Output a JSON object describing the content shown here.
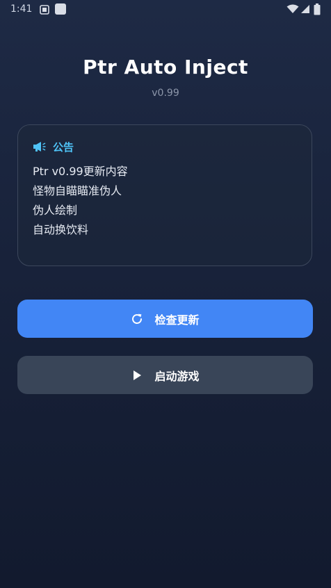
{
  "status_bar": {
    "time": "1:41"
  },
  "app": {
    "title": "Ptr Auto Inject",
    "version": "v0.99"
  },
  "notice": {
    "title": "公告",
    "icon": "megaphone-icon",
    "lines": [
      "Ptr v0.99更新内容",
      "怪物自瞄瞄准伪人",
      "伪人绘制",
      "自动换饮料"
    ]
  },
  "buttons": {
    "update_label": "检查更新",
    "update_icon": "refresh-icon",
    "start_label": "启动游戏",
    "start_icon": "play-icon"
  },
  "colors": {
    "accent_blue": "#4286f5",
    "notice_title": "#4fc3f7",
    "secondary_button": "#394558",
    "background_top": "#1e2a45",
    "background_bottom": "#121a2e"
  }
}
